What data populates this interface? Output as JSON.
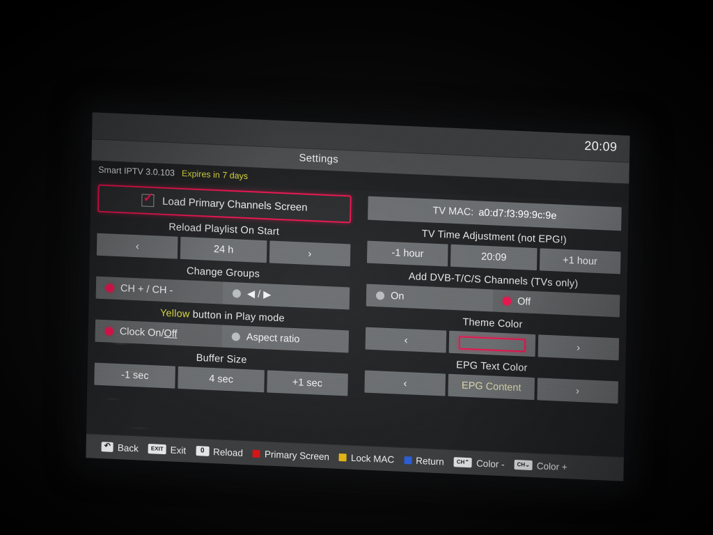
{
  "screen": {
    "clock": "20:09",
    "window_title": "Settings",
    "app_name": "Smart IPTV 3.0.103",
    "expiry_notice": "Expires in 7 days",
    "accent_color": "#e8134f",
    "warning_color": "#d9d93f",
    "epg_text_color": "#ddd6ae"
  },
  "left_column": {
    "primary_screen": {
      "label": "Load Primary Channels Screen",
      "checked": true,
      "check_glyph": "✓"
    },
    "reload_playlist": {
      "label": "Reload Playlist On Start",
      "prev": "‹",
      "value": "24 h",
      "next": "›"
    },
    "change_groups": {
      "label": "Change Groups",
      "options": [
        {
          "label": "CH + / CH -",
          "selected": true
        },
        {
          "label": "◀ / ▶",
          "selected": false
        }
      ]
    },
    "yellow_button": {
      "label_prefix": "Yellow",
      "label_rest": " button in Play mode",
      "options": [
        {
          "label_a": "Clock On/",
          "label_b": "Off",
          "selected": true
        },
        {
          "label_a": "Aspect ratio",
          "label_b": "",
          "selected": false
        }
      ]
    },
    "buffer_size": {
      "label": "Buffer Size",
      "prev": "-1  sec",
      "value": "4 sec",
      "next": "+1  sec"
    }
  },
  "right_column": {
    "tv_mac": {
      "key": "TV MAC:",
      "value": "a0:d7:f3:99:9c:9e"
    },
    "tv_time": {
      "label": "TV Time Adjustment (not EPG!)",
      "prev": "-1  hour",
      "value": "20:09",
      "next": "+1  hour"
    },
    "dvb": {
      "label": "Add DVB-T/C/S Channels (TVs only)",
      "options": [
        {
          "label": "On",
          "selected": false
        },
        {
          "label": "Off",
          "selected": true
        }
      ]
    },
    "theme_color": {
      "label": "Theme Color",
      "prev": "‹",
      "value": "",
      "next": "›"
    },
    "epg_text_color": {
      "label": "EPG Text Color",
      "prev": "‹",
      "value": "EPG Content",
      "next": "›"
    }
  },
  "key_legend": [
    {
      "icon": "return-arrow-key-icon",
      "cap": "↶",
      "cap_type": "glyph",
      "color": "",
      "label": "Back"
    },
    {
      "icon": "exit-key-icon",
      "cap": "EXIT",
      "cap_type": "text",
      "color": "",
      "label": "Exit"
    },
    {
      "icon": "zero-key-icon",
      "cap": "0",
      "cap_type": "digit",
      "color": "",
      "label": "Reload"
    },
    {
      "icon": "red-key-icon",
      "cap": "",
      "cap_type": "color",
      "color": "#d41616",
      "label": "Primary Screen"
    },
    {
      "icon": "yellow-key-icon",
      "cap": "",
      "cap_type": "color",
      "color": "#e2b417",
      "label": "Lock MAC"
    },
    {
      "icon": "blue-key-icon",
      "cap": "",
      "cap_type": "color",
      "color": "#2c5fd6",
      "label": "Return"
    },
    {
      "icon": "channel-up-key-icon",
      "cap": "CH⌃",
      "cap_type": "text",
      "color": "",
      "label": "Color -"
    },
    {
      "icon": "channel-down-key-icon",
      "cap": "CH⌄",
      "cap_type": "text",
      "color": "",
      "label": "Color +"
    }
  ]
}
